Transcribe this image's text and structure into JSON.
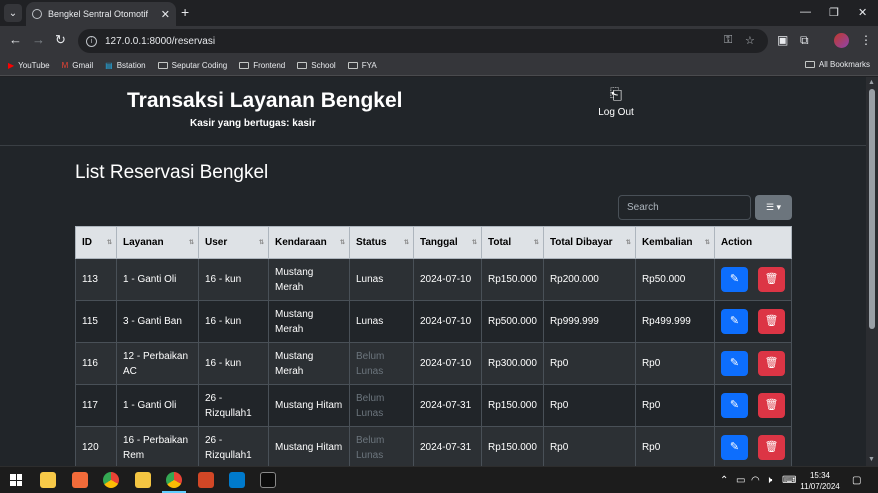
{
  "browser": {
    "tab_title": "Bengkel Sentral Otomotif",
    "url": "127.0.0.1:8000/reservasi",
    "bookmarks": [
      "YouTube",
      "Gmail",
      "Bstation",
      "Seputar Coding",
      "Frontend",
      "School",
      "FYA"
    ],
    "all_bookmarks": "All Bookmarks"
  },
  "header": {
    "title": "Transaksi Layanan Bengkel",
    "subtitle": "Kasir yang bertugas: kasir",
    "logout": "Log Out"
  },
  "main": {
    "title": "List Reservasi Bengkel",
    "search_placeholder": "Search",
    "columns": [
      "ID",
      "Layanan",
      "User",
      "Kendaraan",
      "Status",
      "Tanggal",
      "Total",
      "Total Dibayar",
      "Kembalian",
      "Action"
    ],
    "rows": [
      {
        "id": "113",
        "layanan": "1 - Ganti Oli",
        "user": "16 - kun",
        "kendaraan": "Mustang Merah",
        "status": "Lunas",
        "tanggal": "2024-07-10",
        "total": "Rp150.000",
        "dibayar": "Rp200.000",
        "kembalian": "Rp50.000"
      },
      {
        "id": "115",
        "layanan": "3 - Ganti Ban",
        "user": "16 - kun",
        "kendaraan": "Mustang Merah",
        "status": "Lunas",
        "tanggal": "2024-07-10",
        "total": "Rp500.000",
        "dibayar": "Rp999.999",
        "kembalian": "Rp499.999"
      },
      {
        "id": "116",
        "layanan": "12 - Perbaikan AC",
        "user": "16 - kun",
        "kendaraan": "Mustang Merah",
        "status": "Belum Lunas",
        "tanggal": "2024-07-10",
        "total": "Rp300.000",
        "dibayar": "Rp0",
        "kembalian": "Rp0"
      },
      {
        "id": "117",
        "layanan": "1 - Ganti Oli",
        "user": "26 - Rizqullah1",
        "kendaraan": "Mustang Hitam",
        "status": "Belum Lunas",
        "tanggal": "2024-07-31",
        "total": "Rp150.000",
        "dibayar": "Rp0",
        "kembalian": "Rp0"
      },
      {
        "id": "120",
        "layanan": "16 - Perbaikan Rem",
        "user": "26 - Rizqullah1",
        "kendaraan": "Mustang Hitam",
        "status": "Belum Lunas",
        "tanggal": "2024-07-31",
        "total": "Rp150.000",
        "dibayar": "Rp0",
        "kembalian": "Rp0"
      }
    ]
  },
  "taskbar": {
    "time": "15:34",
    "date": "11/07/2024"
  },
  "colors": {
    "edit": "#0d6efd",
    "delete": "#dc3545",
    "muted_status": "#6c757d"
  }
}
